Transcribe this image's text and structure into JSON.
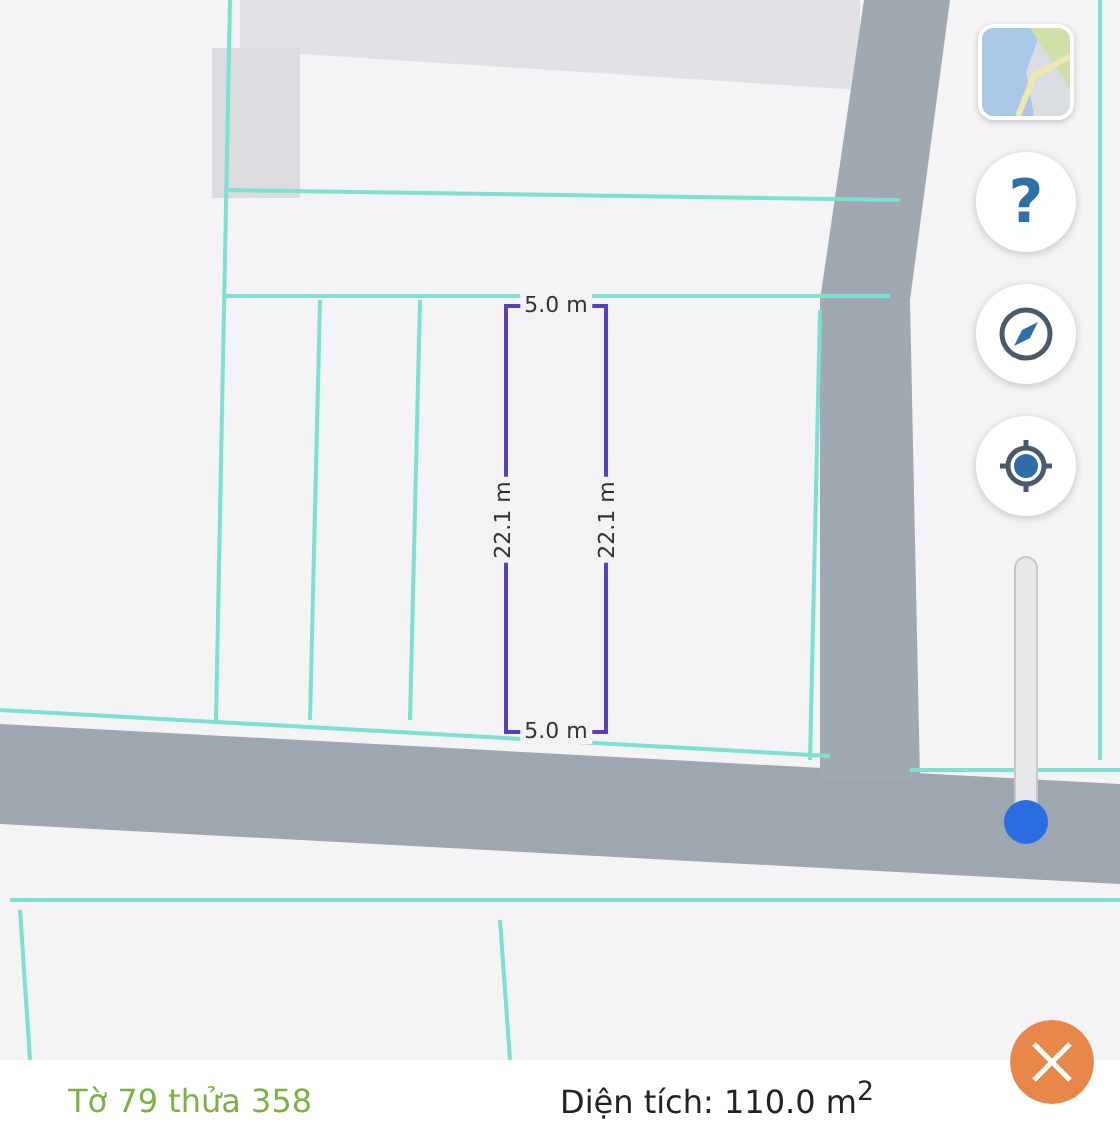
{
  "plot": {
    "top_width": "5.0 m",
    "bottom_width": "5.0 m",
    "left_length": "22.1 m",
    "right_length": "22.1 m"
  },
  "map_controls": [
    {
      "kind": "layers"
    },
    {
      "kind": "help",
      "label": "?"
    },
    {
      "kind": "compass"
    },
    {
      "kind": "locate"
    }
  ],
  "zoom_slider": {
    "level": 0
  },
  "info_bar": {
    "parcel": "Tờ 79 thửa 358",
    "area": "Diện tích: 110.0 m$^{2}$"
  }
}
